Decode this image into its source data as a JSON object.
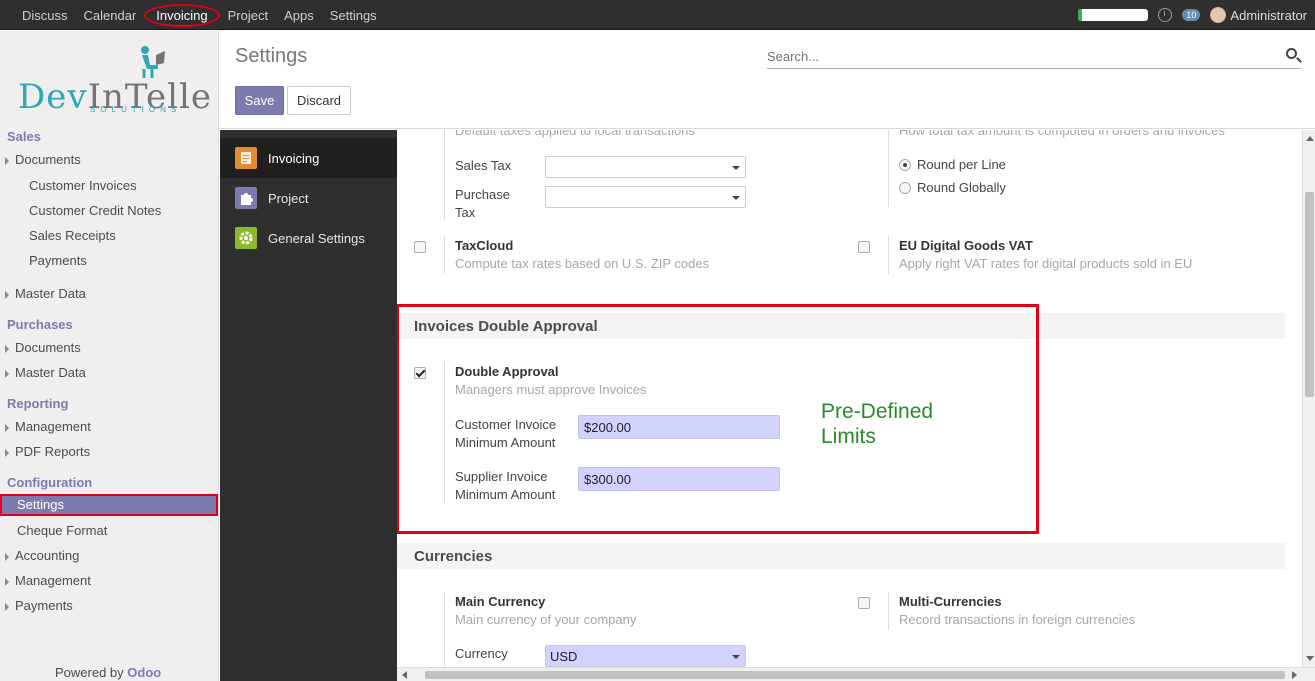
{
  "topnav": {
    "items": [
      "Discuss",
      "Calendar",
      "Invoicing",
      "Project",
      "Apps",
      "Settings"
    ],
    "active": "Invoicing",
    "progress_fraction": 0.05,
    "chat_count": "10",
    "user": "Administrator"
  },
  "sidebar": {
    "logo_text_a": "Dev",
    "logo_text_b": "InTelle",
    "logo_sub": "SOLUTIONS",
    "sections": [
      {
        "title": "Sales",
        "items": [
          {
            "label": "Documents",
            "caret": true
          },
          {
            "label": "Customer Invoices"
          },
          {
            "label": "Customer Credit Notes"
          },
          {
            "label": "Sales Receipts"
          },
          {
            "label": "Payments"
          },
          {
            "label": "Master Data",
            "caret": true
          }
        ]
      },
      {
        "title": "Purchases",
        "items": [
          {
            "label": "Documents",
            "caret": true
          },
          {
            "label": "Master Data",
            "caret": true
          }
        ]
      },
      {
        "title": "Reporting",
        "items": [
          {
            "label": "Management",
            "caret": true
          },
          {
            "label": "PDF Reports",
            "caret": true
          }
        ]
      },
      {
        "title": "Configuration",
        "items": [
          {
            "label": "Settings",
            "selected": true
          },
          {
            "label": "Cheque Format"
          },
          {
            "label": "Accounting",
            "caret": true
          },
          {
            "label": "Management",
            "caret": true
          },
          {
            "label": "Payments",
            "caret": true
          }
        ]
      }
    ],
    "powered_by": "Powered by",
    "powered_brand": "Odoo"
  },
  "control_panel": {
    "title": "Settings",
    "search_placeholder": "Search...",
    "save_label": "Save",
    "discard_label": "Discard"
  },
  "apps": [
    {
      "label": "Invoicing",
      "icon": "invoicing-icon",
      "color": "#e58d2a",
      "active": true
    },
    {
      "label": "Project",
      "icon": "puzzle-icon",
      "color": "#7c7bad"
    },
    {
      "label": "General Settings",
      "icon": "gear-icon",
      "color": "#8dbb28"
    }
  ],
  "content": {
    "default_taxes_desc": "Default taxes applied to local transactions",
    "sales_tax_label": "Sales Tax",
    "purchase_tax_label": "Purchase Tax",
    "tax_rounding_desc": "How total tax amount is computed in orders and invoices",
    "round_per_line": "Round per Line",
    "round_globally": "Round Globally",
    "taxcloud_label": "TaxCloud",
    "taxcloud_desc": "Compute tax rates based on U.S. ZIP codes",
    "eu_vat_label": "EU Digital Goods VAT",
    "eu_vat_desc": "Apply right VAT rates for digital products sold in EU",
    "double_approval_section": "Invoices Double Approval",
    "double_approval_label": "Double Approval",
    "double_approval_desc": "Managers must approve Invoices",
    "customer_min_label": "Customer Invoice Minimum Amount",
    "customer_min_value": "$200.00",
    "supplier_min_label": "Supplier Invoice Minimum Amount",
    "supplier_min_value": "$300.00",
    "annotation": "Pre-Defined Limits",
    "currencies_section": "Currencies",
    "main_currency_label": "Main Currency",
    "main_currency_desc": "Main currency of your company",
    "multi_currency_label": "Multi-Currencies",
    "multi_currency_desc": "Record transactions in foreign currencies",
    "currency_label": "Currency",
    "currency_value": "USD"
  },
  "colors": {
    "brand": "#7c7bad",
    "highlight": "#e0001a",
    "annotation": "#2a8a2a",
    "teal": "#2aa9b7"
  }
}
